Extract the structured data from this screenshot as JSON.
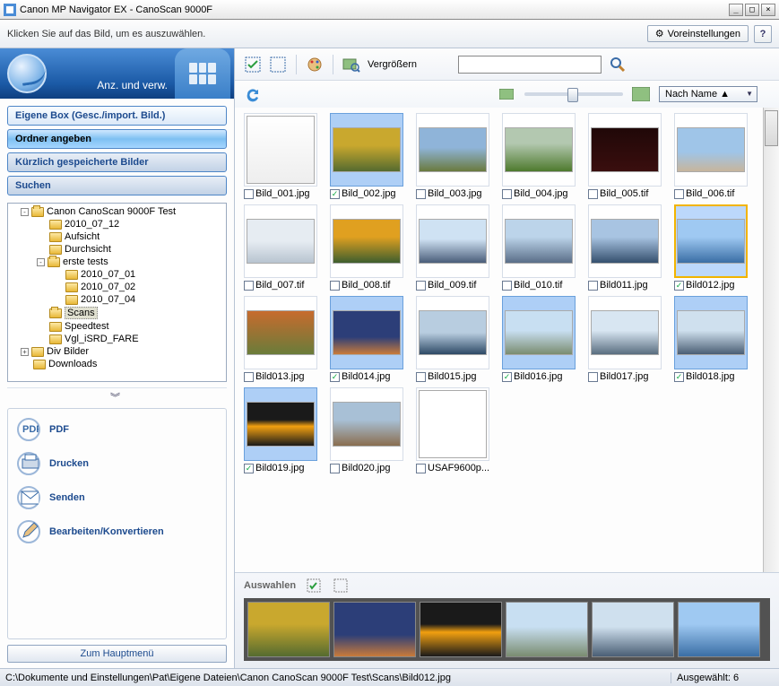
{
  "title": "Canon MP Navigator EX - CanoScan 9000F",
  "topbar": {
    "hint": "Klicken Sie auf das Bild, um es auszuwählen.",
    "prefs": "Voreinstellungen",
    "help": "?"
  },
  "sidehead": {
    "label": "Anz. und verw."
  },
  "sidebtns": [
    {
      "label": "Eigene Box (Gesc./import. Bild.)",
      "cls": ""
    },
    {
      "label": "Ordner angeben",
      "cls": "active"
    },
    {
      "label": "Kürzlich gespeicherte Bilder",
      "cls": "dark"
    },
    {
      "label": "Suchen",
      "cls": "dark"
    }
  ],
  "tree": [
    {
      "d": 0,
      "exp": "-",
      "label": "Canon CanoScan 9000F Test",
      "open": true
    },
    {
      "d": 1,
      "exp": "",
      "label": "2010_07_12"
    },
    {
      "d": 1,
      "exp": "",
      "label": "Aufsicht"
    },
    {
      "d": 1,
      "exp": "",
      "label": "Durchsicht"
    },
    {
      "d": 1,
      "exp": "-",
      "label": "erste tests",
      "open": true
    },
    {
      "d": 2,
      "exp": "",
      "label": "2010_07_01"
    },
    {
      "d": 2,
      "exp": "",
      "label": "2010_07_02"
    },
    {
      "d": 2,
      "exp": "",
      "label": "2010_07_04"
    },
    {
      "d": 1,
      "exp": "",
      "label": "Scans",
      "open": true,
      "sel": true
    },
    {
      "d": 1,
      "exp": "",
      "label": "Speedtest"
    },
    {
      "d": 1,
      "exp": "",
      "label": "Vgl_iSRD_FARE"
    },
    {
      "d": 0,
      "exp": "+",
      "label": "Div Bilder"
    },
    {
      "d": 0,
      "exp": "",
      "label": "Downloads"
    }
  ],
  "actions": [
    {
      "icon": "pdf",
      "label": "PDF"
    },
    {
      "icon": "print",
      "label": "Drucken"
    },
    {
      "icon": "mail",
      "label": "Senden"
    },
    {
      "icon": "edit",
      "label": "Bearbeiten/Konvertieren"
    }
  ],
  "mainbtn": "Zum Hauptmenü",
  "toolbar": {
    "zoom": "Vergrößern"
  },
  "sort": "Nach Name  ▲",
  "thumbs": [
    {
      "name": "Bild_001.jpg",
      "chk": false,
      "sel": false,
      "c": "doc"
    },
    {
      "name": "Bild_002.jpg",
      "chk": true,
      "sel": false,
      "c": "flowers"
    },
    {
      "name": "Bild_003.jpg",
      "chk": false,
      "sel": false,
      "c": "hills"
    },
    {
      "name": "Bild_004.jpg",
      "chk": false,
      "sel": false,
      "c": "field"
    },
    {
      "name": "Bild_005.tif",
      "chk": false,
      "sel": false,
      "c": "dark"
    },
    {
      "name": "Bild_006.tif",
      "chk": false,
      "sel": false,
      "c": "ruins"
    },
    {
      "name": "Bild_007.tif",
      "chk": false,
      "sel": false,
      "c": "snow"
    },
    {
      "name": "Bild_008.tif",
      "chk": false,
      "sel": false,
      "c": "flowers2"
    },
    {
      "name": "Bild_009.tif",
      "chk": false,
      "sel": false,
      "c": "mtn1"
    },
    {
      "name": "Bild_010.tif",
      "chk": false,
      "sel": false,
      "c": "mtn2"
    },
    {
      "name": "Bild011.jpg",
      "chk": false,
      "sel": false,
      "c": "mtn3"
    },
    {
      "name": "Bild012.jpg",
      "chk": true,
      "sel": true,
      "c": "bluemtn"
    },
    {
      "name": "Bild013.jpg",
      "chk": false,
      "sel": false,
      "c": "autumn"
    },
    {
      "name": "Bild014.jpg",
      "chk": true,
      "sel": false,
      "c": "dusk"
    },
    {
      "name": "Bild015.jpg",
      "chk": false,
      "sel": false,
      "c": "coast"
    },
    {
      "name": "Bild016.jpg",
      "chk": true,
      "sel": false,
      "c": "pano"
    },
    {
      "name": "Bild017.jpg",
      "chk": false,
      "sel": false,
      "c": "snowmtn"
    },
    {
      "name": "Bild018.jpg",
      "chk": true,
      "sel": false,
      "c": "snowmtn2"
    },
    {
      "name": "Bild019.jpg",
      "chk": true,
      "sel": false,
      "c": "sunset"
    },
    {
      "name": "Bild020.jpg",
      "chk": false,
      "sel": false,
      "c": "rockmtn"
    },
    {
      "name": "USAF9600p...",
      "chk": false,
      "sel": false,
      "c": "chart"
    }
  ],
  "selstrip": {
    "label": "Auswahlen",
    "items": [
      "flowers",
      "dusk",
      "sunset",
      "pano",
      "snowmtn2",
      "bluemtn"
    ]
  },
  "status": {
    "path": "C:\\Dokumente und Einstellungen\\Pat\\Eigene Dateien\\Canon CanoScan 9000F Test\\Scans\\Bild012.jpg",
    "count": "Ausgewählt: 6"
  },
  "colors": {
    "doc": "linear-gradient(#fff,#eee)",
    "flowers": "linear-gradient(#c9a82e 40%,#556b2f)",
    "hills": "linear-gradient(#8fb4d9 45%,#6a7a3e)",
    "field": "linear-gradient(#b3c8b0 35%,#4e7a2e)",
    "dark": "linear-gradient(#200808,#3a0e0e)",
    "ruins": "linear-gradient(#9fc5e8 55%,#c7b59c)",
    "snow": "linear-gradient(#e6ecf2 50%,#b8c4d0)",
    "flowers2": "linear-gradient(#e0a020 40%,#3e5e2e)",
    "mtn1": "linear-gradient(#cfe2f3 45%,#4a5e7a)",
    "mtn2": "linear-gradient(#bcd4ea 40%,#5a6e88)",
    "mtn3": "linear-gradient(#a8c4e2 40%,#35506e)",
    "bluemtn": "linear-gradient(#9fc9f2 40%,#3a6ea5)",
    "autumn": "linear-gradient(#c76b2e,#6a7c3a)",
    "dusk": "linear-gradient(#2c3e78 60%,#c97b3a)",
    "coast": "linear-gradient(#b8cde0 50%,#2e4a66)",
    "pano": "linear-gradient(#c8dff2 45%,#7a8c70)",
    "snowmtn": "linear-gradient(#d8e6f2 45%,#5a6e80)",
    "snowmtn2": "linear-gradient(#cfe0ee 45%,#4a5e74)",
    "sunset": "linear-gradient(#1a1a1a 40%,#f2a010 55%,#1a1a1a)",
    "rockmtn": "linear-gradient(#a8c0d6 40%,#8a6e50)",
    "chart": "linear-gradient(#fff,#fff)"
  }
}
